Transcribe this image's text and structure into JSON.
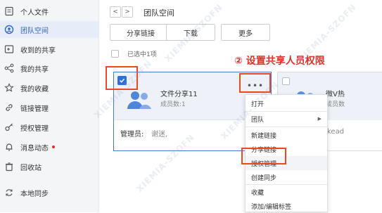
{
  "sidebar": {
    "items": [
      {
        "label": "个人文件",
        "icon": "folder-icon"
      },
      {
        "label": "团队空间",
        "icon": "team-space-icon",
        "active": true
      },
      {
        "label": "收到的共享",
        "icon": "inbox-share-icon"
      },
      {
        "label": "我的共享",
        "icon": "share-icon"
      },
      {
        "label": "我的收藏",
        "icon": "star-icon"
      },
      {
        "label": "链接管理",
        "icon": "link-icon"
      },
      {
        "label": "授权管理",
        "icon": "key-icon"
      },
      {
        "label": "消息动态",
        "icon": "bell-icon",
        "badge_dot": true
      },
      {
        "label": "回收站",
        "icon": "trash-icon"
      },
      {
        "label": "本地同步",
        "icon": "sync-icon"
      }
    ]
  },
  "header": {
    "back": "<",
    "forward": ">",
    "title": "团队空间"
  },
  "toolbar": {
    "share_link": "分享链接",
    "download": "下载",
    "more": "更多"
  },
  "selection": {
    "text": "已选中1项"
  },
  "annotation": {
    "text": "② 设置共享人员权限",
    "color": "#e0302a"
  },
  "card": {
    "name": "文件分享11",
    "member_count": "成员数:1",
    "admin_label": "管理员:",
    "admin_value": "谢迷,",
    "more": "•••"
  },
  "card2": {
    "name": "微V热",
    "member_count": "成员数",
    "extra": "kead"
  },
  "context_menu": {
    "items": [
      {
        "label": "打开"
      },
      {
        "label": "团队",
        "submenu": true
      },
      {
        "label": "新建链接"
      },
      {
        "label": "分享链接"
      },
      {
        "label": "授权管理",
        "highlighted": true
      },
      {
        "label": "创建同步"
      },
      {
        "label": "收藏"
      },
      {
        "label": "添加/编辑标签"
      }
    ]
  },
  "watermark": {
    "text": "XIEMIA-SZOFN"
  },
  "colors": {
    "accent": "#2f6fdd",
    "highlight_border": "#ea4b1e",
    "annotation": "#e0302a"
  }
}
